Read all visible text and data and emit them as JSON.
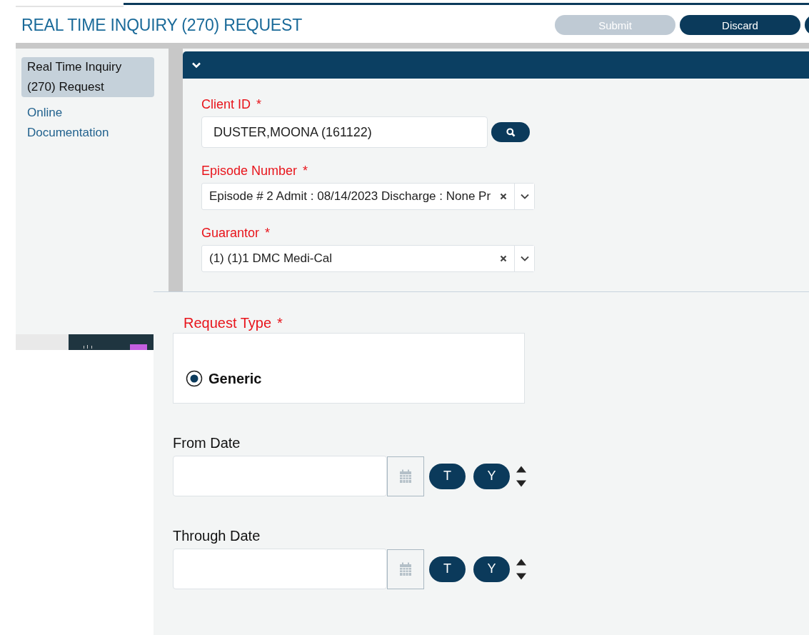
{
  "header": {
    "title": "REAL TIME INQUIRY (270) REQUEST",
    "buttons": [
      {
        "label": "Submit",
        "disabled": true
      },
      {
        "label": "Discard",
        "disabled": false
      }
    ]
  },
  "sidebar": {
    "items": [
      {
        "label": "Real Time Inquiry (270) Request",
        "selected": true
      },
      {
        "label": "Online Documentation",
        "selected": false
      }
    ]
  },
  "section": {
    "expanded": true,
    "fields": [
      {
        "kind": "lookup",
        "label": "Client ID",
        "required_mark": "*",
        "value": "DUSTER,MOONA (161122)"
      },
      {
        "kind": "select",
        "label": "Episode Number",
        "required_mark": "*",
        "value": "Episode # 2 Admit : 08/14/2023 Discharge : None Pr"
      },
      {
        "kind": "select",
        "label": "Guarantor",
        "required_mark": "*",
        "value": "(1) (1)1 DMC Medi-Cal"
      }
    ]
  },
  "request_form": {
    "request_type": {
      "label": "Request Type",
      "required_mark": "*",
      "options": [
        {
          "label": "Generic",
          "selected": true
        }
      ]
    },
    "date_fields": [
      {
        "label": "From Date",
        "shortcuts": [
          "T",
          "Y"
        ]
      },
      {
        "label": "Through Date",
        "shortcuts": [
          "T",
          "Y"
        ]
      }
    ]
  }
}
